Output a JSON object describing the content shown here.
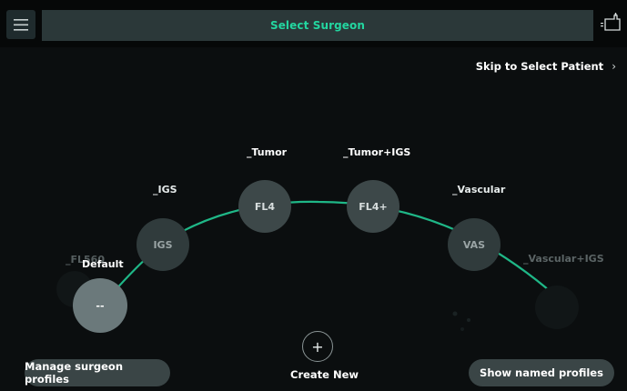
{
  "header": {
    "title": "Select Surgeon",
    "menu_icon": "hamburger-menu-icon",
    "device_icon": "device-status-icon",
    "accent_color": "#23d6a0"
  },
  "skip": {
    "label": "Skip to Select Patient",
    "chevron": "›"
  },
  "profiles": [
    {
      "name": "_FL560",
      "badge": ""
    },
    {
      "name": "Default",
      "badge": "--"
    },
    {
      "name": "_IGS",
      "badge": "IGS"
    },
    {
      "name": "_Tumor",
      "badge": "FL4"
    },
    {
      "name": "_Tumor+IGS",
      "badge": "FL4+"
    },
    {
      "name": "_Vascular",
      "badge": "VAS"
    },
    {
      "name": "_Vascular+IGS",
      "badge": ""
    }
  ],
  "create": {
    "symbol": "+",
    "label": "Create New"
  },
  "buttons": {
    "manage": "Manage surgeon profiles",
    "show_named": "Show named profiles"
  }
}
